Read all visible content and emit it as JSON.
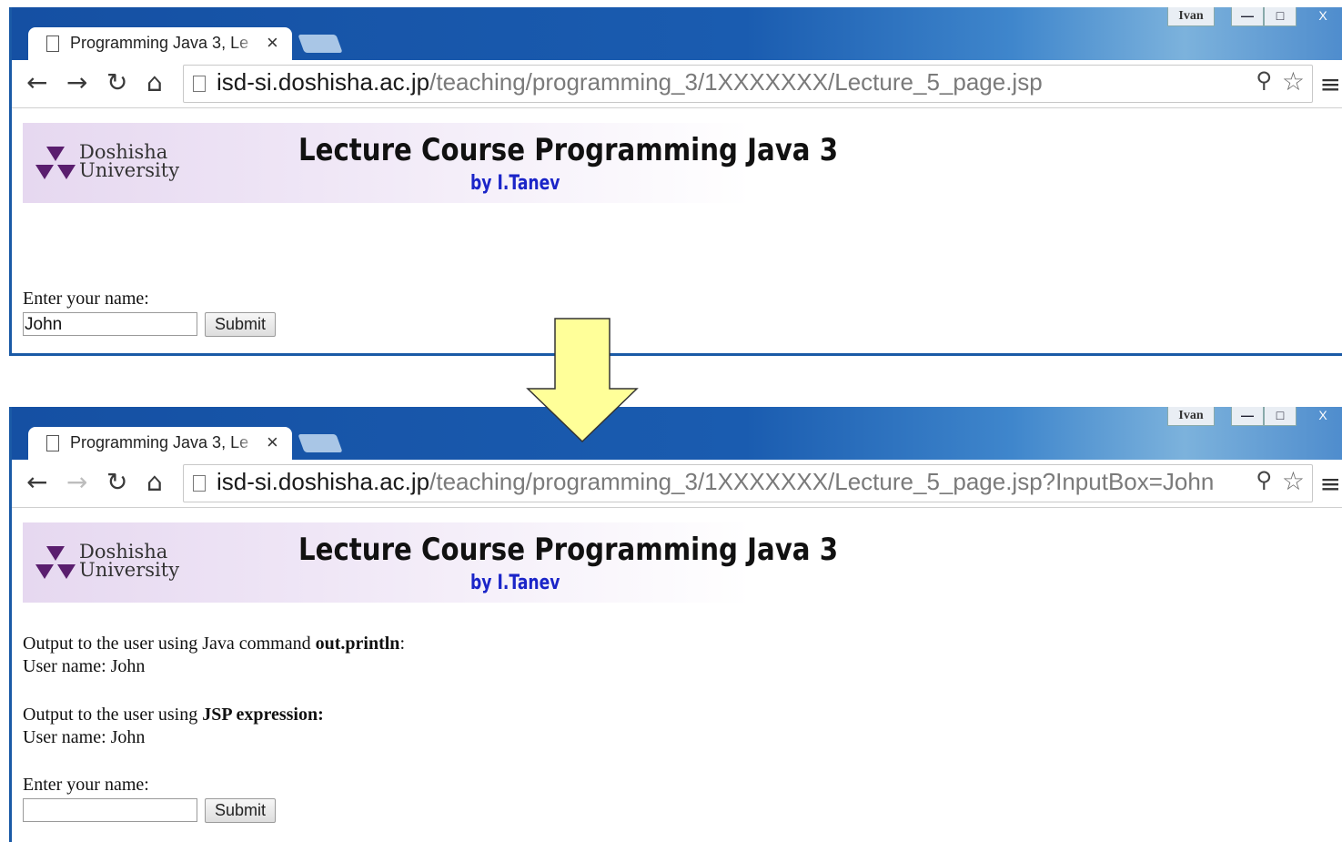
{
  "windows": [
    {
      "tab_title": "Programming Java 3, Le",
      "tab_close": "×",
      "user": "Ivan",
      "url_host": "isd-si.doshisha.ac.jp",
      "url_path": "/teaching/programming_3/1XXXXXXX/Lecture_5_page.jsp",
      "banner": {
        "university_line1": "Doshisha",
        "university_line2": "University",
        "title": "Lecture Course Programming Java 3",
        "author": "by I.Tanev"
      },
      "form": {
        "label": "Enter your name:",
        "input_value": "John",
        "submit_label": "Submit"
      }
    },
    {
      "tab_title": "Programming Java 3, Le",
      "tab_close": "×",
      "user": "Ivan",
      "url_host": "isd-si.doshisha.ac.jp",
      "url_path": "/teaching/programming_3/1XXXXXXX/Lecture_5_page.jsp?InputBox=John",
      "banner": {
        "university_line1": "Doshisha",
        "university_line2": "University",
        "title": "Lecture Course Programming Java 3",
        "author": "by I.Tanev"
      },
      "output": {
        "line1_prefix": "Output to the user using Java command ",
        "line1_bold": "out.println",
        "line1_suffix": ":",
        "line2": "User name: John",
        "line3_prefix": "Output to the user using ",
        "line3_bold": "JSP expression:",
        "line4": "User name: John"
      },
      "form": {
        "label": "Enter your name:",
        "input_value": "",
        "submit_label": "Submit"
      }
    }
  ],
  "icons": {
    "back": "←",
    "forward": "→",
    "reload": "↻",
    "home": "⌂",
    "zoom": "⚲",
    "star": "☆",
    "menu": "≡",
    "minimize": "—",
    "maximize": "□",
    "close": "X"
  },
  "colors": {
    "titlebar": "#1550a3",
    "arrow_fill": "#ffff99",
    "author": "#1b25c8",
    "banner": "#e6d8f0"
  }
}
